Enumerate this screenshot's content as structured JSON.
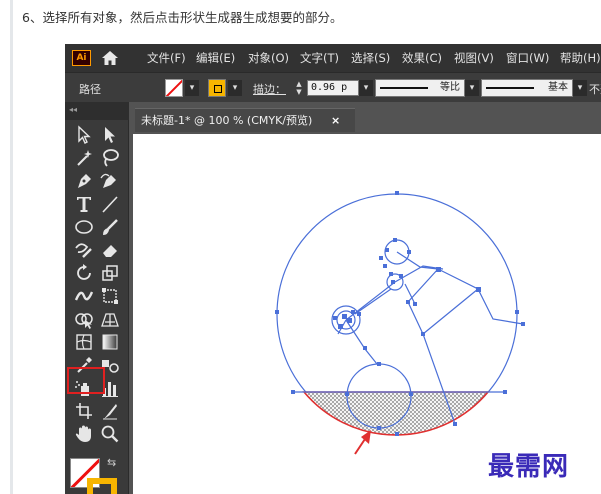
{
  "step_instruction": "6、选择所有对象，然后点击形状生成器生成想要的部分。",
  "app": {
    "logo": "Ai",
    "menu": [
      "文件(F)",
      "编辑(E)",
      "对象(O)",
      "文字(T)",
      "选择(S)",
      "效果(C)",
      "视图(V)",
      "窗口(W)",
      "帮助(H)"
    ]
  },
  "control_bar": {
    "path_label": "路径",
    "stroke_label": "描边：",
    "stroke_width": "0.96 p",
    "profile_label": "等比",
    "brush_label": "基本",
    "opacity_label": "不透"
  },
  "document": {
    "tab_title": "未标题-1* @ 100 % (CMYK/预览)",
    "close_glyph": "×"
  },
  "toolbox": {
    "grip_glyph": "◂◂",
    "tools": [
      "selection-tool",
      "direct-selection-tool",
      "magic-wand-tool",
      "lasso-tool",
      "pen-tool",
      "curvature-tool",
      "type-tool",
      "line-tool",
      "ellipse-tool",
      "paintbrush-tool",
      "shaper-tool",
      "eraser-tool",
      "rotate-tool",
      "scale-tool",
      "width-tool",
      "free-transform-tool",
      "shape-builder-tool",
      "perspective-grid-tool",
      "mesh-tool",
      "gradient-tool",
      "eyedropper-tool",
      "blend-tool",
      "symbol-sprayer-tool",
      "column-graph-tool",
      "artboard-tool",
      "slice-tool",
      "hand-tool",
      "zoom-tool"
    ],
    "active_tool": "shape-builder-tool",
    "fill_color": "#ffffff",
    "stroke_color": "#f7b500"
  },
  "colors": {
    "selection_blue": "#4a6fd8",
    "highlight_red": "#e03030",
    "ui_dark": "#323232"
  },
  "watermark": "最需网"
}
